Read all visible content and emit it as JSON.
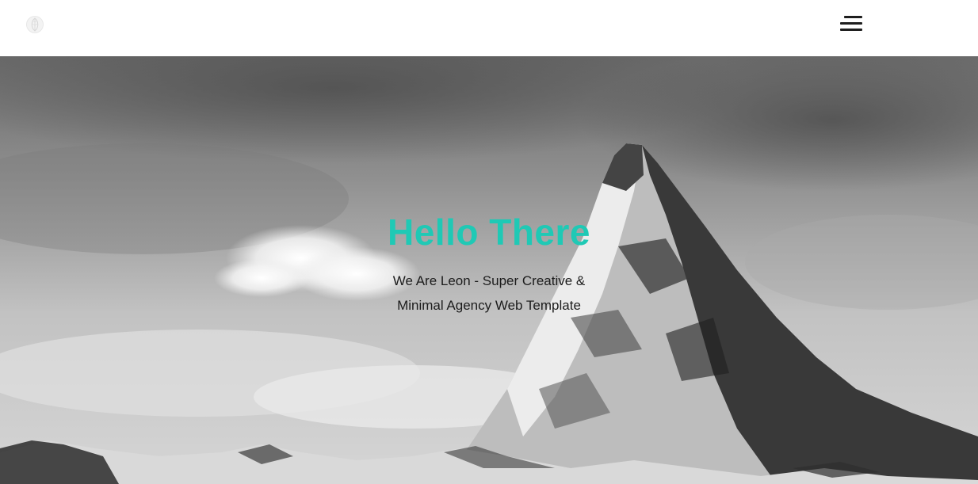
{
  "header": {
    "logo_icon": "leaf-logo-icon",
    "menu_icon": "hamburger-menu-icon"
  },
  "hero": {
    "title": "Hello There",
    "subtitle": "We Are Leon - Super Creative & Minimal Agency Web Template",
    "background": "mountain-peak-photo-grayscale",
    "accent_color": "#1fc9b5"
  }
}
